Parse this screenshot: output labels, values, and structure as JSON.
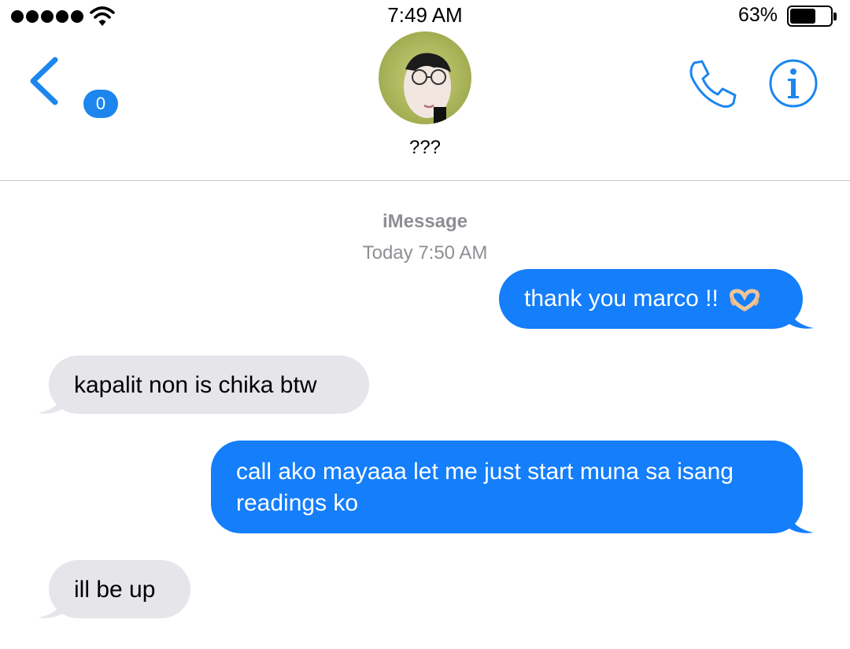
{
  "status_bar": {
    "time": "7:49 AM",
    "battery_percent": "63%",
    "battery_level": 0.63,
    "signal_dots": 5,
    "wifi_icon": "wifi-icon"
  },
  "header": {
    "back_badge": "0",
    "contact_name": "???",
    "icons": {
      "back": "chevron-left-icon",
      "call": "phone-icon",
      "info": "info-icon"
    }
  },
  "thread": {
    "service_label": "iMessage",
    "timestamp": "Today 7:50 AM"
  },
  "messages": [
    {
      "direction": "sent",
      "text": "thank you marco !!",
      "emoji": "heart-hands-icon"
    },
    {
      "direction": "received",
      "text": "kapalit non is chika btw"
    },
    {
      "direction": "sent",
      "line1": "call ako mayaaa let me just start muna sa isang",
      "line2": "readings ko"
    },
    {
      "direction": "received",
      "text": "ill be up"
    }
  ],
  "colors": {
    "accent": "#1c86ee",
    "sent_bubble": "#147efb",
    "received_bubble": "#e5e5ea",
    "secondary_text": "#8e8e93"
  }
}
